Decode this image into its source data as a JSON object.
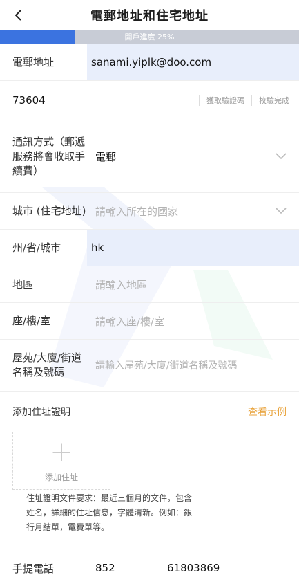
{
  "header": {
    "title": "電郵地址和住宅地址"
  },
  "progress": {
    "label": "開戶進度 25%",
    "value": 0.25
  },
  "form": {
    "email": {
      "label": "電郵地址",
      "value": "sanami.yiplk@doo.com"
    },
    "code": {
      "value": "73604",
      "get_code": "獲取驗證碼",
      "verified": "校驗完成"
    },
    "comm": {
      "label": "通訊方式（郵遞服務將會收取手續費）",
      "value": "電郵"
    },
    "city": {
      "label": "城市 (住宅地址)",
      "placeholder": "請輸入所在的國家"
    },
    "state": {
      "label": "州/省/城市",
      "value": "hk"
    },
    "district": {
      "label": "地區",
      "placeholder": "請輸入地區"
    },
    "flat": {
      "label": "座/樓/室",
      "placeholder": "請輸入座/樓/室"
    },
    "estate": {
      "label": "屋苑/大廈/街道名稱及號碼",
      "placeholder": "請輸入屋苑/大廈/街道名稱及號碼"
    }
  },
  "proof": {
    "title": "添加住址證明",
    "example_link": "查看示例",
    "upload_label": "添加住址",
    "note": "住址證明文件要求：最近三個月的文件，包含姓名，詳細的住址信息，字體清新。例如：銀行月結單，電費單等。"
  },
  "mobile": {
    "label": "手提電話",
    "country_code": "852",
    "number": "61803869"
  }
}
